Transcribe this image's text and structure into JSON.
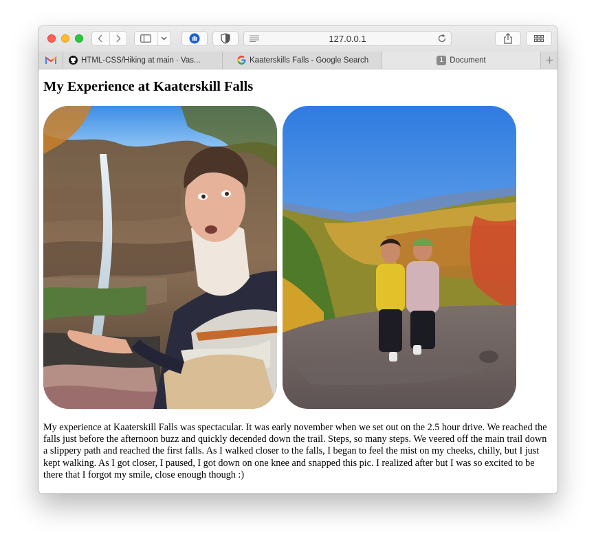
{
  "browser": {
    "address": "127.0.0.1",
    "tabs": [
      {
        "label": "",
        "icon": "gmail-icon"
      },
      {
        "label": "HTML-CSS/Hiking at main · Vas...",
        "icon": "github-icon"
      },
      {
        "label": "Kaaterskills Falls - Google Search",
        "icon": "google-icon"
      },
      {
        "label": "Document",
        "badge": "1",
        "active": true
      }
    ]
  },
  "page": {
    "title": "My Experience at Kaaterskill Falls",
    "paragraph": "My experience at Kaaterskill Falls was spectacular. It was early november when we set out on the 2.5 hour drive. We reached the falls just before the afternoon buzz and quickly decended down the trail. Steps, so many steps. We veered off the main trail down a slippery path and reached the first falls. As I walked closer to the falls, I began to feel the mist on my cheeks, chilly, but I just kept walking. As I got closer, I paused, I got down on one knee and snapped this pic. I realized after but I was so excited to be there that I forgot my smile, close enough though :)"
  },
  "colors": {
    "close": "#fe5f57",
    "minimize": "#febc2e",
    "zoom": "#28c840"
  }
}
